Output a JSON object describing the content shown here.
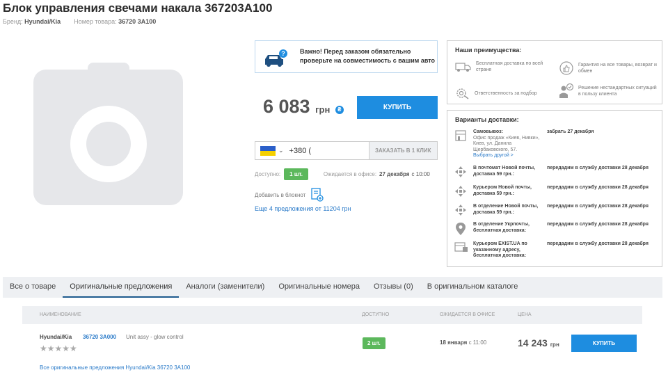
{
  "product": {
    "title": "Блок управления свечами накала 367203A100",
    "brand_label": "Бренд:",
    "brand": "Hyundai/Kia",
    "number_label": "Номер товара:",
    "number": "36720 3A100"
  },
  "compat": {
    "line1": "Важно! Перед заказом обязательно",
    "line2": "проверьте на совместимость с вашим авто"
  },
  "price": {
    "value": "6 083",
    "currency": "грн"
  },
  "buy_label": "КУПИТЬ",
  "phone": {
    "prefix": "+380 (",
    "order_label": "ЗАКАЗАТЬ В 1 КЛИК"
  },
  "availability": {
    "label": "Доступно:",
    "qty": "1 шт.",
    "expected_label": "Ожидается в офисе:",
    "date": "27 декабря",
    "time": "с 10:00"
  },
  "notebook_label": "Добавить в блокнот",
  "more_offers": "Еще 4 предложения от 11204 грн",
  "advantages": {
    "title": "Наши преимущества:",
    "items": [
      "Бесплатная доставка по всей стране",
      "Гарантия на все товары, возврат и обмен",
      "Ответственность за подбор",
      "Решение нестандартных ситуаций в пользу клиента"
    ]
  },
  "delivery": {
    "title": "Варианты доставки:",
    "rows": [
      {
        "name": "Самовывоз:",
        "sub": "Офис продаж «Киев, Нивки», Киев, ул. Данила Щербаковского, 57.",
        "link": "Выбрать другой >",
        "when": "забрать 27 декабря"
      },
      {
        "name": "В почтомат Новой почты, доставка 59 грн.:",
        "when": "передадим в службу доставки 28 декабря"
      },
      {
        "name": "Курьером Новой почты, доставка 59 грн.:",
        "when": "передадим в службу доставки 28 декабря"
      },
      {
        "name": "В отделение Новой почты, доставка 59 грн.:",
        "when": "передадим в службу доставки 28 декабря"
      },
      {
        "name": "В отделение Укрпочты, бесплатная доставка:",
        "when": "передадим в службу доставки 28 декабря"
      },
      {
        "name": "Курьером EXIST.UA по указанному адресу, бесплатная доставка:",
        "when": "передадим в службу доставки 28 декабря"
      }
    ]
  },
  "tabs": [
    "Все о товаре",
    "Оригинальные предложения",
    "Аналоги (заменители)",
    "Оригинальные номера",
    "Отзывы (0)",
    "В оригинальном каталоге"
  ],
  "active_tab": "Оригинальные предложения",
  "table": {
    "headers": [
      "НАИМЕНОВАНИЕ",
      "ДОСТУПНО",
      "ОЖИДАЕТСЯ В ОФИСЕ",
      "ЦЕНА"
    ],
    "row": {
      "brand": "Hyundai/Kia",
      "number": "36720 3A000",
      "desc": "Unit assy - glow control",
      "qty": "2 шт.",
      "eta_date": "18 января",
      "eta_time": "с 11:00",
      "price": "14 243",
      "currency": "грн",
      "buy": "КУПИТЬ"
    }
  },
  "all_offers": "Все оригинальные предложения Hyundai/Kia 36720 3A100",
  "colors": {
    "accent": "#1e8de0",
    "success": "#5cb85c",
    "link": "#2b7bc9"
  }
}
